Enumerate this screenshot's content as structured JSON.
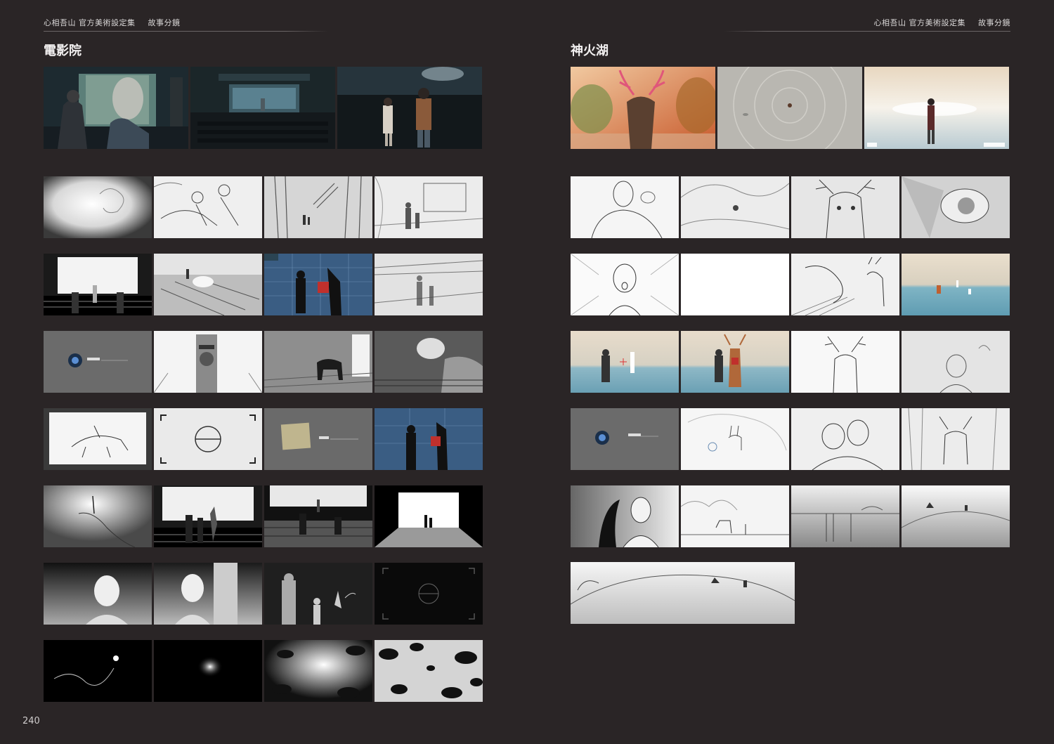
{
  "header": {
    "book_title": "心相吾山 官方美術設定集",
    "chapter": "故事分鏡"
  },
  "left_page": {
    "section_title": "電影院",
    "page_number": "240"
  },
  "right_page": {
    "section_title": "神火湖"
  },
  "colors": {
    "page_bg": "#2a2526",
    "title_text": "#f2f0f0",
    "header_text": "#d9d7d7",
    "rule_line": "#6b6566"
  }
}
